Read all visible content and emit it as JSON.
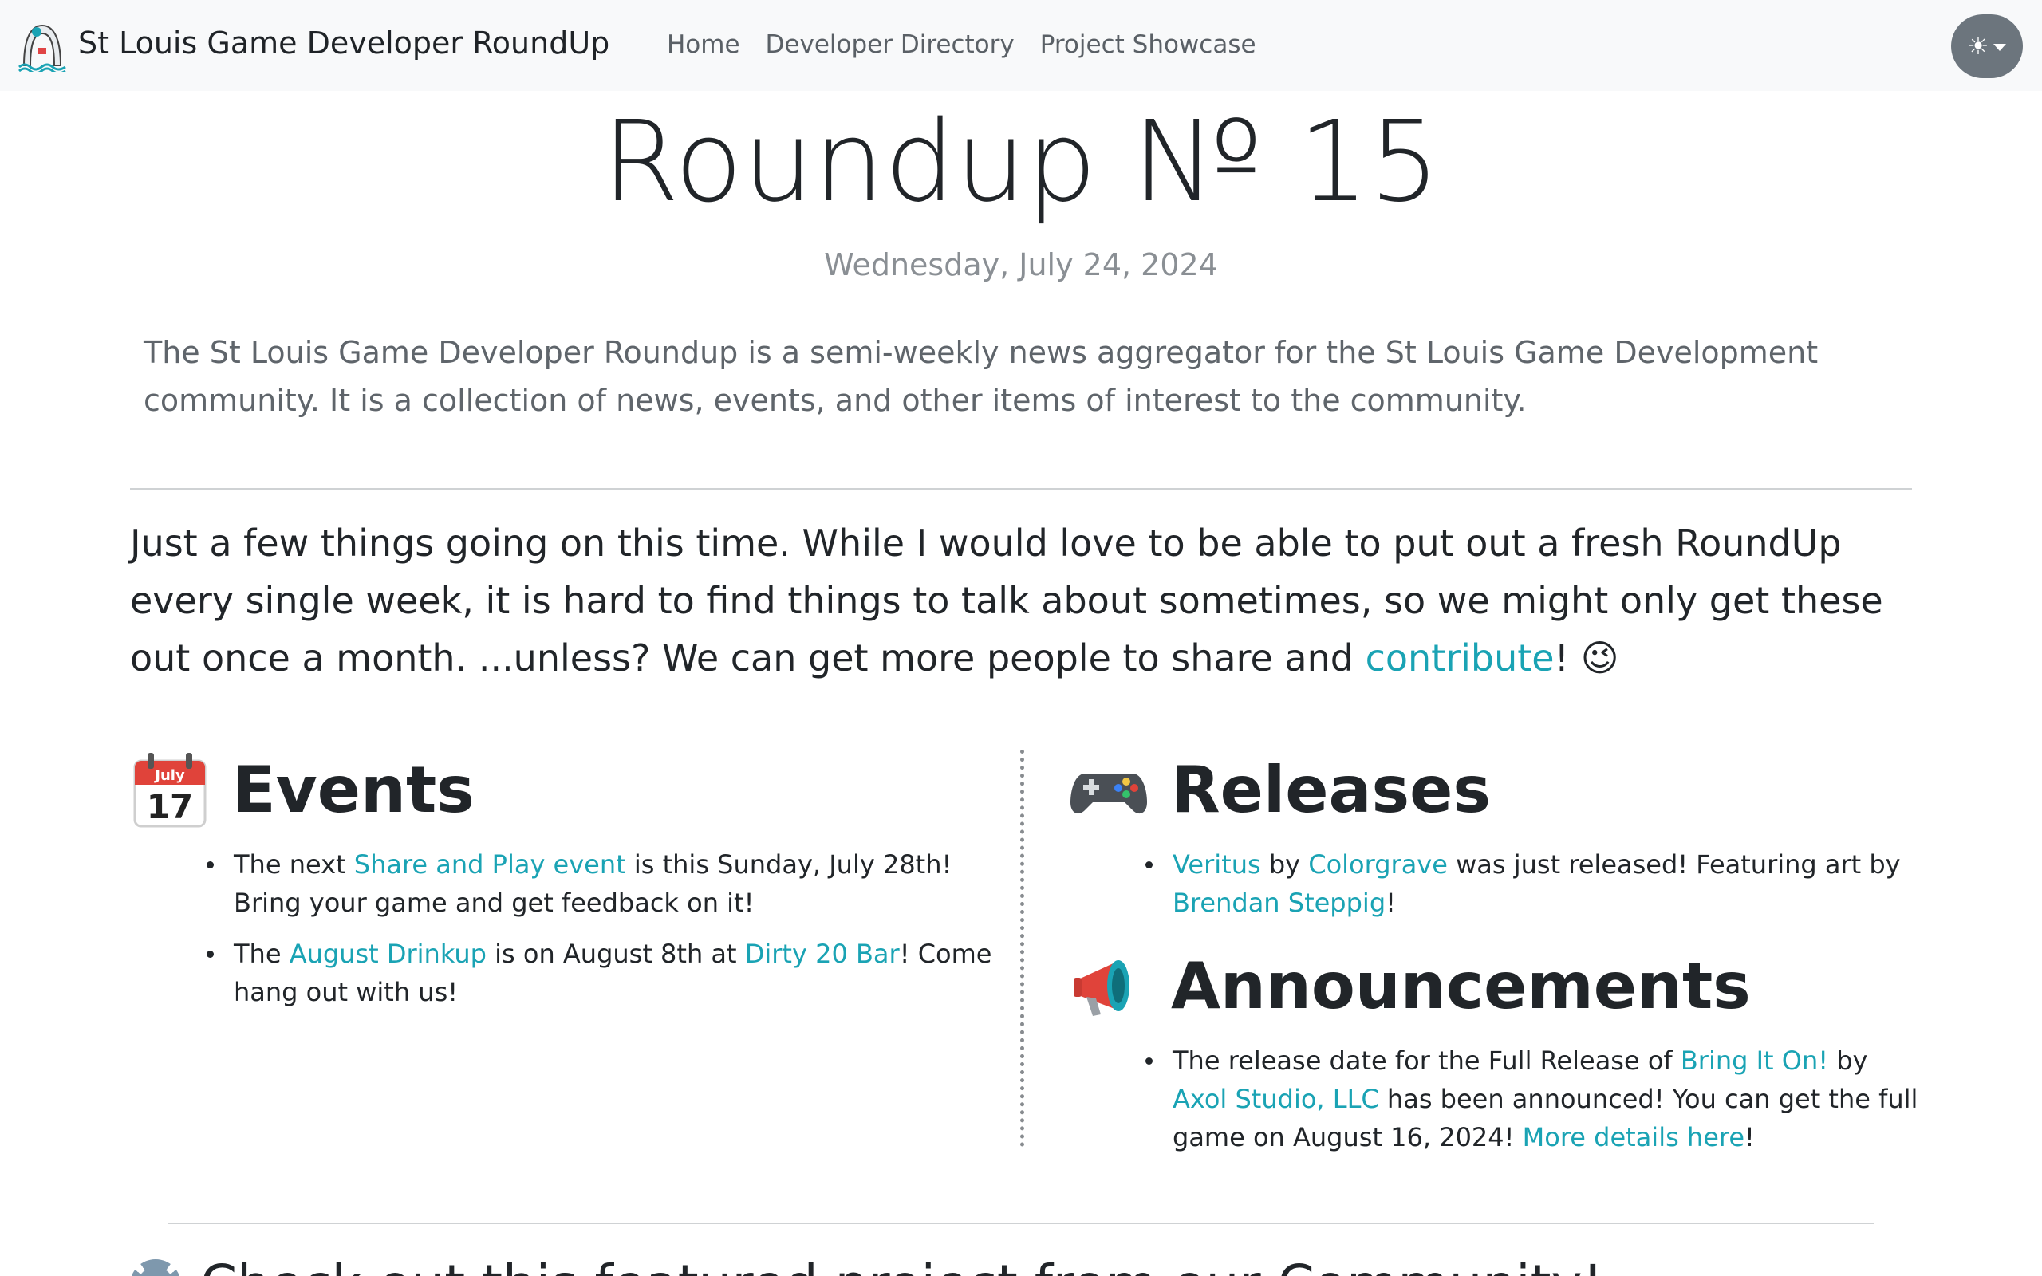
{
  "nav": {
    "brand": "St Louis Game Developer RoundUp",
    "links": [
      "Home",
      "Developer Directory",
      "Project Showcase"
    ],
    "theme_icon": "☀"
  },
  "header": {
    "title": "Roundup № 15",
    "date": "Wednesday, July 24, 2024",
    "lead": "The St Louis Game Developer Roundup is a semi-weekly news aggregator for the St Louis Game Development community. It is a collection of news, events, and other items of interest to the community."
  },
  "intro": {
    "text": "Just a few things going on this time. While I would love to be able to put out a fresh RoundUp every single week, it is hard to find things to talk about sometimes, so we might only get these out once a month. ...unless? We can get more people to share and ",
    "link": "contribute",
    "tail": "! 😉"
  },
  "events": {
    "heading": "Events",
    "calendar_month": "July",
    "calendar_day": "17",
    "item1": {
      "a": "The next ",
      "link": "Share and Play event",
      "b": " is this Sunday, July 28th! Bring your game and get feedback on it!"
    },
    "item2": {
      "a": "The ",
      "link1": "August Drinkup",
      "b": " is on August 8th at ",
      "link2": "Dirty 20 Bar",
      "c": "! Come hang out with us!"
    }
  },
  "releases": {
    "heading": "Releases",
    "item1": {
      "link1": "Veritus",
      "a": " by ",
      "link2": "Colorgrave",
      "b": " was just released! Featuring art by ",
      "link3": "Brendan Steppig",
      "c": "!"
    }
  },
  "announcements": {
    "heading": "Announcements",
    "item1": {
      "a": "The release date for the Full Release of ",
      "link1": "Bring It On!",
      "b": " by ",
      "link2": "Axol Studio, LLC",
      "c": " has been announced! You can get the full game on August 16, 2024! ",
      "link3": "More details here",
      "d": "!"
    }
  },
  "bottom": {
    "heading": "Check out this featured project from our Community!"
  },
  "colors": {
    "link": "#1aa3b4",
    "navbar_bg": "#f8f9fa",
    "theme_button": "#6c757d"
  }
}
